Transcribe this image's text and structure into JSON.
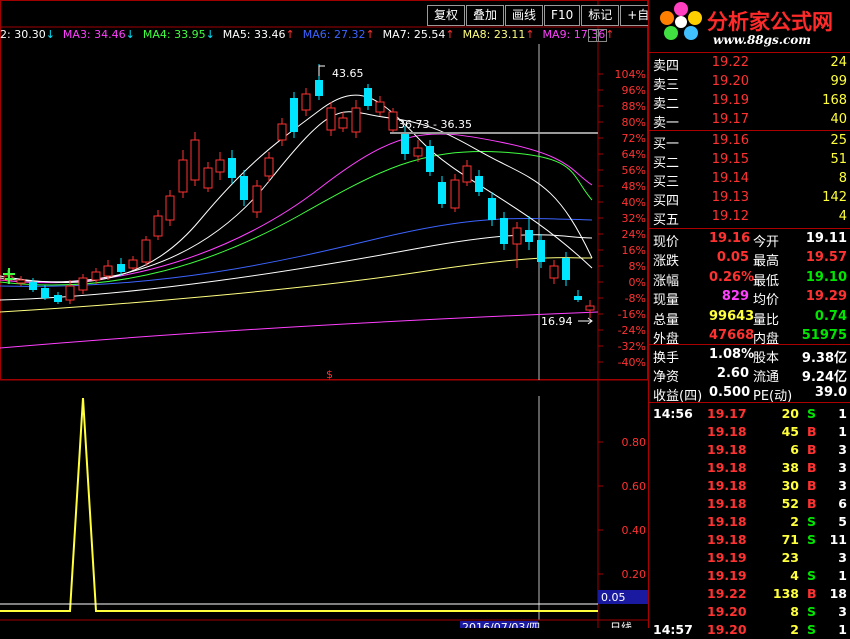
{
  "toolbar": {
    "buttons": [
      "复权",
      "叠加",
      "画线",
      "F10",
      "标记",
      "+自选"
    ]
  },
  "ma_legend": [
    {
      "label": "2: 30.30",
      "arrow": "↓",
      "color": "#ffffff"
    },
    {
      "label": "MA3: 34.46",
      "arrow": "↓",
      "color": "#ff40ff"
    },
    {
      "label": "MA4: 33.95",
      "arrow": "↓",
      "color": "#40ff40"
    },
    {
      "label": "MA5: 33.46",
      "arrow": "↑",
      "color": "#ffffff"
    },
    {
      "label": "MA6: 27.32",
      "arrow": "↑",
      "color": "#3c64ff"
    },
    {
      "label": "MA7: 25.54",
      "arrow": "↑",
      "color": "#ffffff"
    },
    {
      "label": "MA8: 23.11",
      "arrow": "↑",
      "color": "#ffff80"
    },
    {
      "label": "MA9: 17.36",
      "arrow": "↑",
      "color": "#ff40ff"
    }
  ],
  "upper_chart": {
    "pct_labels": [
      "104%",
      "96%",
      "88%",
      "80%",
      "72%",
      "64%",
      "56%",
      "48%",
      "40%",
      "32%",
      "24%",
      "16%",
      "8%",
      "0%",
      "-8%",
      "-16%",
      "-24%",
      "-32%",
      "-40%"
    ],
    "pct_values": [
      104,
      96,
      88,
      80,
      72,
      64,
      56,
      48,
      40,
      32,
      24,
      16,
      8,
      0,
      -8,
      -16,
      -24,
      -32,
      -40
    ],
    "annotations": {
      "high": "43.65",
      "low": "16.94",
      "segment": "36.73 - 36.35",
      "marker": "$"
    }
  },
  "lower_chart": {
    "levels": [
      "0.80",
      "0.60",
      "0.40",
      "0.20"
    ],
    "level_values": [
      0.8,
      0.6,
      0.4,
      0.2
    ],
    "current_value": "0.05",
    "date": "2016/07/03/四",
    "timeframe": "日线"
  },
  "logo": {
    "name": "分析家公式网",
    "url": "www.88gs.com"
  },
  "order_book": {
    "asks": [
      {
        "label": "卖四",
        "price": "19.22",
        "vol": "24"
      },
      {
        "label": "卖三",
        "price": "19.20",
        "vol": "99"
      },
      {
        "label": "卖二",
        "price": "19.19",
        "vol": "168"
      },
      {
        "label": "卖一",
        "price": "19.17",
        "vol": "40"
      }
    ],
    "bids": [
      {
        "label": "买一",
        "price": "19.16",
        "vol": "25"
      },
      {
        "label": "买二",
        "price": "19.15",
        "vol": "51"
      },
      {
        "label": "买三",
        "price": "19.14",
        "vol": "8"
      },
      {
        "label": "买四",
        "price": "19.13",
        "vol": "142"
      },
      {
        "label": "买五",
        "price": "19.12",
        "vol": "4"
      }
    ]
  },
  "quote": [
    {
      "l1": "现价",
      "v1": "19.16",
      "c1": "red",
      "l2": "今开",
      "v2": "19.11",
      "c2": "white"
    },
    {
      "l1": "涨跌",
      "v1": "0.05",
      "c1": "red",
      "l2": "最高",
      "v2": "19.57",
      "c2": "red"
    },
    {
      "l1": "涨幅",
      "v1": "0.26%",
      "c1": "red",
      "l2": "最低",
      "v2": "19.10",
      "c2": "green"
    },
    {
      "l1": "现量",
      "v1": "829",
      "c1": "magenta",
      "l2": "均价",
      "v2": "19.29",
      "c2": "red"
    },
    {
      "l1": "总量",
      "v1": "99643",
      "c1": "yellow",
      "l2": "量比",
      "v2": "0.74",
      "c2": "green"
    },
    {
      "l1": "外盘",
      "v1": "47668",
      "c1": "red",
      "l2": "内盘",
      "v2": "51975",
      "c2": "green"
    }
  ],
  "stats": [
    {
      "l1": "换手",
      "v1": "1.08%",
      "l2": "股本",
      "v2": "9.38亿"
    },
    {
      "l1": "净资",
      "v1": "2.60",
      "l2": "流通",
      "v2": "9.24亿"
    },
    {
      "l1": "收益(四)",
      "v1": "0.500",
      "l2": "PE(动)",
      "v2": "39.0"
    }
  ],
  "ticks": [
    {
      "time": "14:56",
      "price": "19.17",
      "pc": "red",
      "vol": "20",
      "bs": "S",
      "n": "1"
    },
    {
      "time": "",
      "price": "19.18",
      "pc": "red",
      "vol": "45",
      "bs": "B",
      "n": "1"
    },
    {
      "time": "",
      "price": "19.18",
      "pc": "red",
      "vol": "6",
      "bs": "B",
      "n": "3"
    },
    {
      "time": "",
      "price": "19.18",
      "pc": "red",
      "vol": "38",
      "bs": "B",
      "n": "3"
    },
    {
      "time": "",
      "price": "19.18",
      "pc": "red",
      "vol": "30",
      "bs": "B",
      "n": "3"
    },
    {
      "time": "",
      "price": "19.18",
      "pc": "red",
      "vol": "52",
      "bs": "B",
      "n": "6"
    },
    {
      "time": "",
      "price": "19.18",
      "pc": "red",
      "vol": "2",
      "bs": "S",
      "n": "5"
    },
    {
      "time": "",
      "price": "19.18",
      "pc": "red",
      "vol": "71",
      "bs": "S",
      "n": "11"
    },
    {
      "time": "",
      "price": "19.19",
      "pc": "red",
      "vol": "23",
      "bs": "",
      "n": "3"
    },
    {
      "time": "",
      "price": "19.19",
      "pc": "red",
      "vol": "4",
      "bs": "S",
      "n": "1"
    },
    {
      "time": "",
      "price": "19.22",
      "pc": "red",
      "vol": "138",
      "bs": "B",
      "n": "18"
    },
    {
      "time": "",
      "price": "19.20",
      "pc": "red",
      "vol": "8",
      "bs": "S",
      "n": "3"
    },
    {
      "time": "14:57",
      "price": "19.20",
      "pc": "red",
      "vol": "2",
      "bs": "S",
      "n": "1"
    }
  ],
  "colors": {
    "up": "#ff3232",
    "down": "#00e5ff",
    "grid": "#a00000",
    "yellow": "#ffff3c"
  }
}
